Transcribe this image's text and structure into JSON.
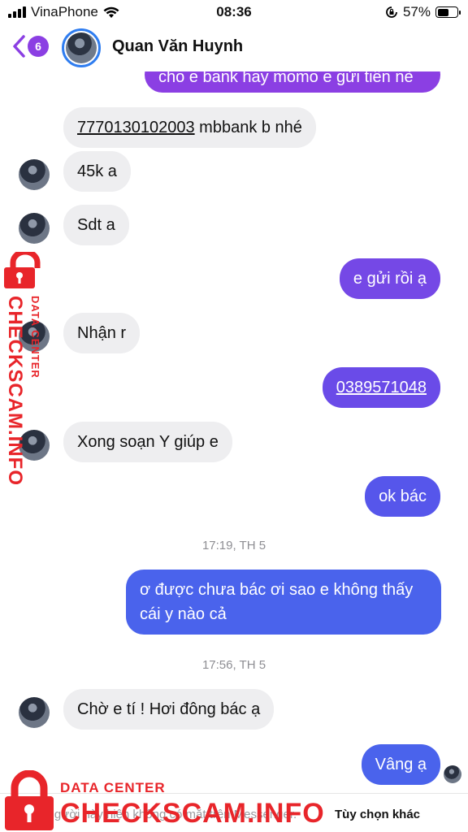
{
  "status_bar": {
    "carrier": "VinaPhone",
    "time": "08:36",
    "battery": "57%",
    "battery_level": 0.57
  },
  "header": {
    "unread_count": "6",
    "contact_name": "Quan Văn Huynh"
  },
  "messages": [
    {
      "dir": "out",
      "text": "cho e bank hay momo e gửi tiền nè"
    },
    {
      "dir": "in",
      "parts": [
        {
          "text": "7770130102003",
          "link": true
        },
        {
          "text": " mbbank b nhé"
        }
      ]
    },
    {
      "dir": "in",
      "text": "45k a"
    },
    {
      "dir": "in",
      "text": "Sdt a"
    },
    {
      "dir": "out",
      "text": "e gửi rồi ạ"
    },
    {
      "dir": "in",
      "text": "Nhận r"
    },
    {
      "dir": "out",
      "text": "0389571048",
      "link": true
    },
    {
      "dir": "in",
      "text": "Xong soạn Y giúp e"
    },
    {
      "dir": "out",
      "text": "ok bác"
    },
    {
      "dir": "time",
      "text": "17:19, TH 5"
    },
    {
      "dir": "out",
      "lines": [
        "ơ được chưa bác ơi sao e không thấy",
        "cái y nào cả"
      ]
    },
    {
      "dir": "time",
      "text": "17:56, TH 5"
    },
    {
      "dir": "in",
      "text": "Chờ e tí ! Hơi đông bác ạ"
    },
    {
      "dir": "out",
      "text": "Vâng ạ"
    }
  ],
  "bottom_bar": {
    "note": "Người này hiện không có mặt trên Messenger.",
    "action": "Tùy chọn khác"
  },
  "watermark": {
    "small": "DATA CENTER",
    "big": "CHECKSCAM.INFO"
  },
  "colors": {
    "bubble_purple": "#8b3fe3",
    "bubble_violet": "#6a4be8",
    "bubble_blue": "#4a63ec",
    "bubble_incoming": "#eeeef0",
    "watermark_red": "#e8252a"
  }
}
